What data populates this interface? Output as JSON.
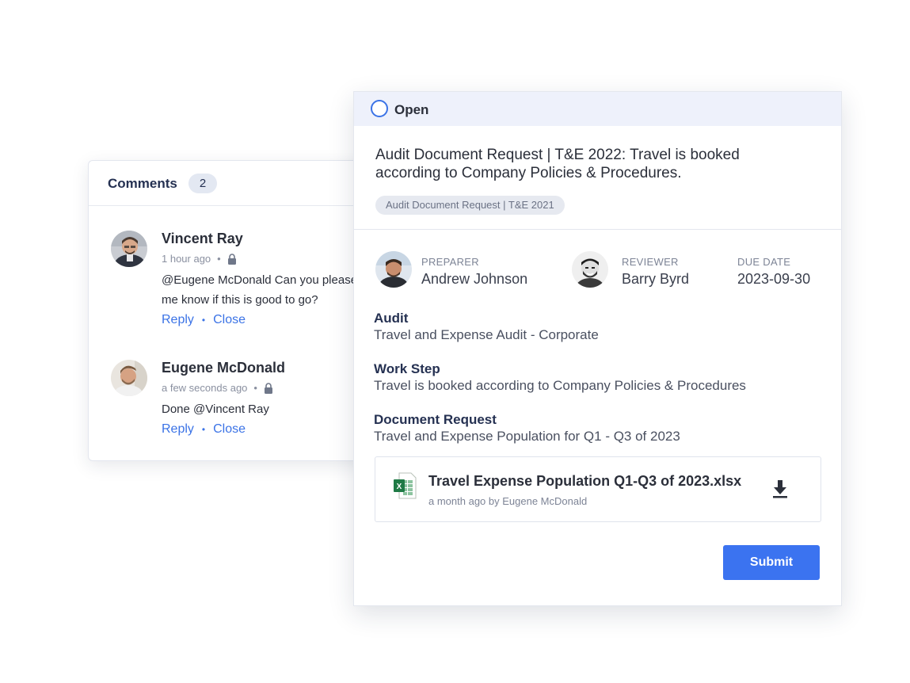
{
  "comments": {
    "title": "Comments",
    "count": "2",
    "items": [
      {
        "author": "Vincent Ray",
        "time": "1 hour ago",
        "text_mention": "@Eugene McDonald",
        "text_line1": " Can you please",
        "text_line2": "me know if this is good to go?",
        "reply_label": "Reply",
        "close_label": "Close"
      },
      {
        "author": "Eugene McDonald",
        "time": "a few seconds ago",
        "text_prefix": "Done ",
        "text_mention": "@Vincent Ray",
        "reply_label": "Reply",
        "close_label": "Close"
      }
    ]
  },
  "request": {
    "status": "Open",
    "title": "Audit Document Request | T&E 2022: Travel is booked according to Company Policies & Procedures.",
    "tag": "Audit Document Request | T&E 2021",
    "preparer_label": "PREPARER",
    "preparer_name": "Andrew Johnson",
    "reviewer_label": "REVIEWER",
    "reviewer_name": "Barry Byrd",
    "due_label": "DUE DATE",
    "due_date": "2023-09-30",
    "audit_label": "Audit",
    "audit_value": "Travel and Expense Audit - Corporate",
    "workstep_label": "Work Step",
    "workstep_value": "Travel is booked according to Company Policies & Procedures",
    "docrequest_label": "Document Request",
    "docrequest_value": "Travel and Expense Population for Q1 - Q3 of 2023",
    "file_name": "Travel Expense Population Q1-Q3 of 2023.xlsx",
    "file_meta": "a month ago by Eugene McDonald",
    "submit_label": "Submit"
  },
  "icons": {
    "status": "open-circle-icon",
    "lock": "lock-icon",
    "file": "excel-file-icon",
    "download": "download-icon"
  },
  "colors": {
    "accent": "#3b73f0",
    "link": "#3b73e6",
    "heading": "#253152",
    "status_bar": "#eef1fb"
  }
}
